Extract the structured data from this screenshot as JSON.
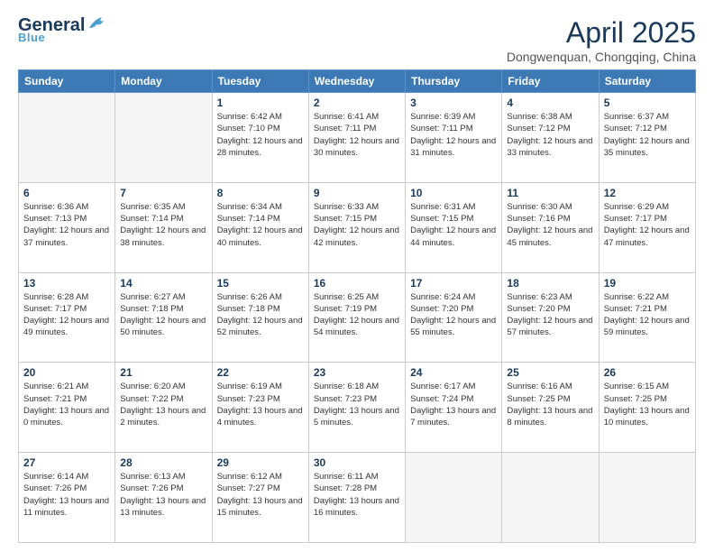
{
  "logo": {
    "general": "General",
    "blue": "Blue"
  },
  "header": {
    "title": "April 2025",
    "subtitle": "Dongwenquan, Chongqing, China"
  },
  "weekdays": [
    "Sunday",
    "Monday",
    "Tuesday",
    "Wednesday",
    "Thursday",
    "Friday",
    "Saturday"
  ],
  "weeks": [
    [
      {
        "day": "",
        "empty": true
      },
      {
        "day": "",
        "empty": true
      },
      {
        "day": "1",
        "sunrise": "6:42 AM",
        "sunset": "7:10 PM",
        "daylight": "12 hours and 28 minutes."
      },
      {
        "day": "2",
        "sunrise": "6:41 AM",
        "sunset": "7:11 PM",
        "daylight": "12 hours and 30 minutes."
      },
      {
        "day": "3",
        "sunrise": "6:39 AM",
        "sunset": "7:11 PM",
        "daylight": "12 hours and 31 minutes."
      },
      {
        "day": "4",
        "sunrise": "6:38 AM",
        "sunset": "7:12 PM",
        "daylight": "12 hours and 33 minutes."
      },
      {
        "day": "5",
        "sunrise": "6:37 AM",
        "sunset": "7:12 PM",
        "daylight": "12 hours and 35 minutes."
      }
    ],
    [
      {
        "day": "6",
        "sunrise": "6:36 AM",
        "sunset": "7:13 PM",
        "daylight": "12 hours and 37 minutes."
      },
      {
        "day": "7",
        "sunrise": "6:35 AM",
        "sunset": "7:14 PM",
        "daylight": "12 hours and 38 minutes."
      },
      {
        "day": "8",
        "sunrise": "6:34 AM",
        "sunset": "7:14 PM",
        "daylight": "12 hours and 40 minutes."
      },
      {
        "day": "9",
        "sunrise": "6:33 AM",
        "sunset": "7:15 PM",
        "daylight": "12 hours and 42 minutes."
      },
      {
        "day": "10",
        "sunrise": "6:31 AM",
        "sunset": "7:15 PM",
        "daylight": "12 hours and 44 minutes."
      },
      {
        "day": "11",
        "sunrise": "6:30 AM",
        "sunset": "7:16 PM",
        "daylight": "12 hours and 45 minutes."
      },
      {
        "day": "12",
        "sunrise": "6:29 AM",
        "sunset": "7:17 PM",
        "daylight": "12 hours and 47 minutes."
      }
    ],
    [
      {
        "day": "13",
        "sunrise": "6:28 AM",
        "sunset": "7:17 PM",
        "daylight": "12 hours and 49 minutes."
      },
      {
        "day": "14",
        "sunrise": "6:27 AM",
        "sunset": "7:18 PM",
        "daylight": "12 hours and 50 minutes."
      },
      {
        "day": "15",
        "sunrise": "6:26 AM",
        "sunset": "7:18 PM",
        "daylight": "12 hours and 52 minutes."
      },
      {
        "day": "16",
        "sunrise": "6:25 AM",
        "sunset": "7:19 PM",
        "daylight": "12 hours and 54 minutes."
      },
      {
        "day": "17",
        "sunrise": "6:24 AM",
        "sunset": "7:20 PM",
        "daylight": "12 hours and 55 minutes."
      },
      {
        "day": "18",
        "sunrise": "6:23 AM",
        "sunset": "7:20 PM",
        "daylight": "12 hours and 57 minutes."
      },
      {
        "day": "19",
        "sunrise": "6:22 AM",
        "sunset": "7:21 PM",
        "daylight": "12 hours and 59 minutes."
      }
    ],
    [
      {
        "day": "20",
        "sunrise": "6:21 AM",
        "sunset": "7:21 PM",
        "daylight": "13 hours and 0 minutes."
      },
      {
        "day": "21",
        "sunrise": "6:20 AM",
        "sunset": "7:22 PM",
        "daylight": "13 hours and 2 minutes."
      },
      {
        "day": "22",
        "sunrise": "6:19 AM",
        "sunset": "7:23 PM",
        "daylight": "13 hours and 4 minutes."
      },
      {
        "day": "23",
        "sunrise": "6:18 AM",
        "sunset": "7:23 PM",
        "daylight": "13 hours and 5 minutes."
      },
      {
        "day": "24",
        "sunrise": "6:17 AM",
        "sunset": "7:24 PM",
        "daylight": "13 hours and 7 minutes."
      },
      {
        "day": "25",
        "sunrise": "6:16 AM",
        "sunset": "7:25 PM",
        "daylight": "13 hours and 8 minutes."
      },
      {
        "day": "26",
        "sunrise": "6:15 AM",
        "sunset": "7:25 PM",
        "daylight": "13 hours and 10 minutes."
      }
    ],
    [
      {
        "day": "27",
        "sunrise": "6:14 AM",
        "sunset": "7:26 PM",
        "daylight": "13 hours and 11 minutes."
      },
      {
        "day": "28",
        "sunrise": "6:13 AM",
        "sunset": "7:26 PM",
        "daylight": "13 hours and 13 minutes."
      },
      {
        "day": "29",
        "sunrise": "6:12 AM",
        "sunset": "7:27 PM",
        "daylight": "13 hours and 15 minutes."
      },
      {
        "day": "30",
        "sunrise": "6:11 AM",
        "sunset": "7:28 PM",
        "daylight": "13 hours and 16 minutes."
      },
      {
        "day": "",
        "empty": true
      },
      {
        "day": "",
        "empty": true
      },
      {
        "day": "",
        "empty": true
      }
    ]
  ]
}
